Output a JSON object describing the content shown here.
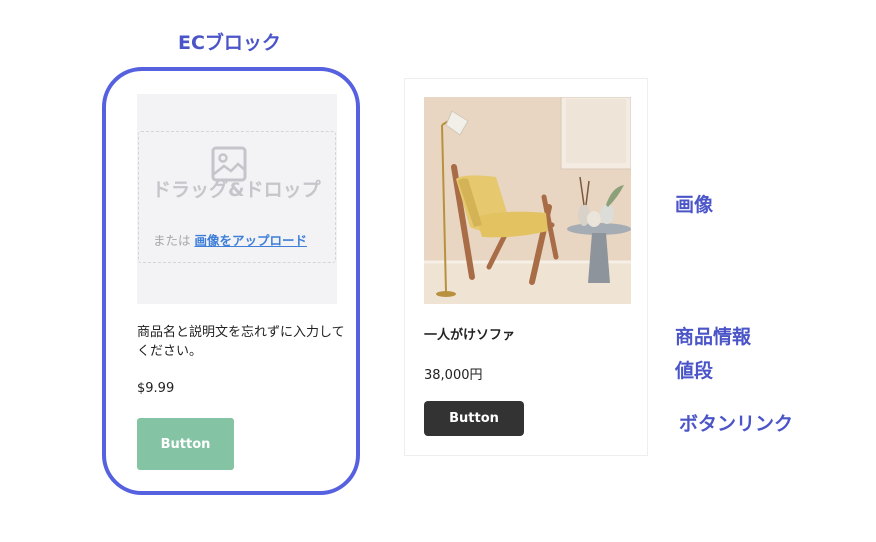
{
  "annotations": {
    "block_title": "ECブロック",
    "image_label": "画像",
    "product_info_label": "商品情報",
    "price_label": "値段",
    "button_link_label": "ボタンリンク"
  },
  "left_card": {
    "drag_drop": "ドラッグ&ドロップ",
    "or_text": "または",
    "upload_link": "画像をアップロード",
    "description": "商品名と説明文を忘れずに入力してください。",
    "price": "$9.99",
    "button_label": "Button"
  },
  "right_card": {
    "product_name": "一人がけソファ",
    "price": "38,000円",
    "button_label": "Button"
  },
  "colors": {
    "annotation": "#4b55c8",
    "outline": "#5661e0",
    "green_button": "#84c3a3",
    "dark_button": "#333333",
    "link": "#3f7fd8"
  },
  "icons": {
    "placeholder": "image-placeholder-icon"
  }
}
